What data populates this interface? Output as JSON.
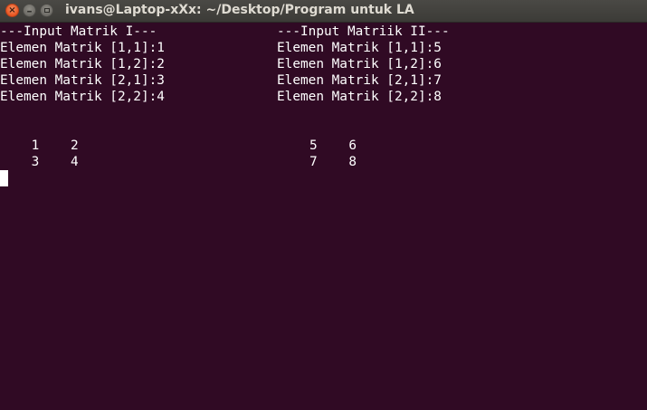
{
  "window": {
    "title": "ivans@Laptop-xXx: ~/Desktop/Program untuk LA",
    "buttons": {
      "close_icon": "close-icon",
      "minimize_icon": "minimize-icon",
      "maximize_icon": "maximize-icon"
    }
  },
  "colors": {
    "terminal_bg": "#300a24",
    "terminal_fg": "#ffffff",
    "titlebar_bg": "#3c3b37",
    "close_button": "#e95420"
  },
  "terminal": {
    "left_header": "---Input Matrik I---",
    "right_header": "---Input Matriik II---",
    "left_inputs": [
      "Elemen Matrik [1,1]:1",
      "Elemen Matrik [1,2]:2",
      "Elemen Matrik [2,1]:3",
      "Elemen Matrik [2,2]:4"
    ],
    "right_inputs": [
      "Elemen Matrik [1,1]:5",
      "Elemen Matrik [1,2]:6",
      "Elemen Matrik [2,1]:7",
      "Elemen Matrik [2,2]:8"
    ],
    "matrix1_rows": [
      "    1    2",
      "    3    4"
    ],
    "matrix2_rows": [
      "5    6",
      "7    8"
    ]
  }
}
